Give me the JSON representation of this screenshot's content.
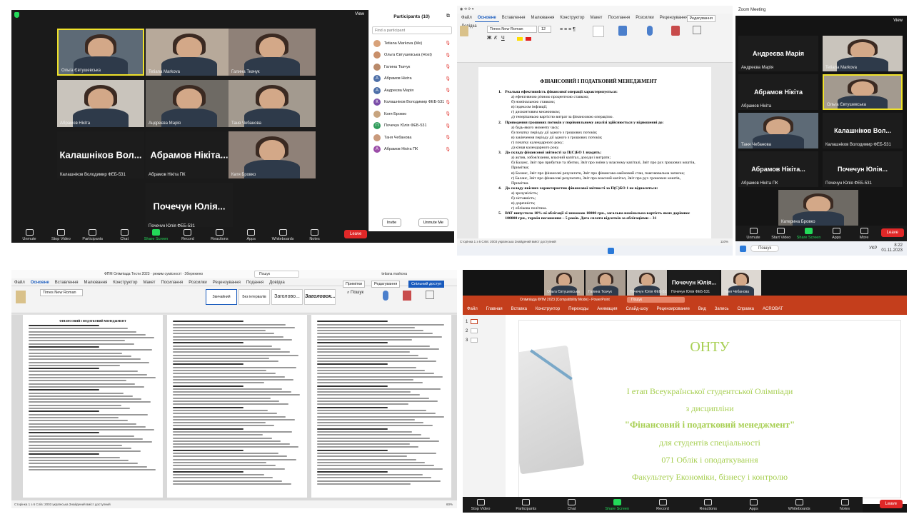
{
  "q1": {
    "view_label": "View",
    "tiles": [
      {
        "name": "Ольга Євтушевська",
        "type": "photo"
      },
      {
        "name": "Tetiana Markova",
        "type": "photo"
      },
      {
        "name": "Галина Ткачук",
        "type": "photo"
      },
      {
        "name": "Абрамов Нікіта",
        "type": "photo"
      },
      {
        "name": "Андреєва Марія",
        "type": "photo"
      },
      {
        "name": "Таня Чебанова",
        "type": "photo"
      },
      {
        "name": "Калашніков Володимир ФЕБ-531",
        "type": "text",
        "big": "Калашніков Вол..."
      },
      {
        "name": "Абрамов Нікіта ПК",
        "type": "text",
        "big": "Абрамов Нікіта..."
      },
      {
        "name": "Катя Бровко",
        "type": "photo"
      },
      {
        "name": "Почечун Юлія ФЕБ-531",
        "type": "text",
        "big": "Почечун Юлія..."
      }
    ],
    "participants": {
      "title": "Participants (10)",
      "search_placeholder": "Find a participant",
      "list": [
        {
          "name": "Tetiana Markova (Me)",
          "color": "#d8a27a"
        },
        {
          "name": "Ольга Євтушевська (Host)",
          "color": "#c9906b"
        },
        {
          "name": "Галина Ткачук",
          "color": "#b98a6a"
        },
        {
          "name": "Абрамов Нікіта",
          "color": "#4d6fa8",
          "letter": "А"
        },
        {
          "name": "Андреєва Марія",
          "color": "#4d6fa8",
          "letter": "А"
        },
        {
          "name": "Калашніков Володимир ФЕБ-531",
          "color": "#7a4da8",
          "letter": "К"
        },
        {
          "name": "Катя Бровко",
          "color": "#c7a47f"
        },
        {
          "name": "Почечун Юлія ФЕБ-531",
          "color": "#2f9c5a",
          "letter": "П"
        },
        {
          "name": "Таня Чебанова",
          "color": "#c99a7c"
        },
        {
          "name": "Абрамов Нікіта ПК",
          "color": "#9b4da8",
          "letter": "А"
        }
      ],
      "invite": "Invite",
      "unmute": "Unmute Me"
    },
    "toolbar": [
      "Unmute",
      "Stop Video",
      "Participants",
      "Chat",
      "Share Screen",
      "Record",
      "Reactions",
      "Apps",
      "Whiteboards",
      "Notes"
    ],
    "leave": "Leave"
  },
  "q2": {
    "tabs": [
      "Файл",
      "Основне",
      "Вставлення",
      "Малювання",
      "Конструктор",
      "Макет",
      "Посилання",
      "Розсилки",
      "Рецензування",
      "Подання",
      "Довідка"
    ],
    "font": "Times New Roman",
    "size": "12",
    "edit_label": "Редагування",
    "title": "ФІНАНСОВИЙ І ПОДАТКОВИЙ МЕНЕДЖМЕНТ",
    "questions": [
      {
        "num": "1.",
        "q": "Реальна ефективність фінансової операції характеризується:",
        "a": [
          "а) ефективною річною процентною ставкою;",
          "б) номінальною ставкою;",
          "в) індексом інфляції;",
          "г) дисконтовим множником;",
          "д) теперішньою вартістю витрат за фінансовою операцією."
        ]
      },
      {
        "num": "2.",
        "q": "Приведення грошових потоків у порівняльному аналізі здійснюється у відношенні до:",
        "a": [
          "а) будь-якого моменту часу;",
          "б) початку періоду дії одного з грошових потоків;",
          "в) закінчення періоду дії одного з грошових потоків;",
          "г) початку календарного року;",
          "д) кінця календарного року."
        ]
      },
      {
        "num": "3.",
        "q": "До складу фінансової звітності за П(С)БО 1 входять:",
        "a": [
          "а) актив, зобов'язання, власний капітал, доходи і витрати;",
          "б) Баланс, Звіт про прибутки та збитки, Звіт про зміни у власному капіталі, Звіт про рух грошових коштів, Примітки;",
          "в) Баланс, Звіт про фінансові результати, Звіт про фінансово-майновий стан, пояснювальна записка;",
          "г) Баланс, Звіт про фінансові результати, Звіт про власний капітал, Звіт про рух грошових коштів, Примітки."
        ]
      },
      {
        "num": "4.",
        "q": "До складу якісних характеристик фінансової звітності за П(С)БО 1 не відноситься:",
        "a": [
          "а) зрозумілість;",
          "б) зіставність;",
          "в) доречність;",
          "г) обліковa політика."
        ]
      },
      {
        "num": "5.",
        "q": "ВАТ випустило 10%-ві облігації зі знижкою 10000 грн., загальна номінальна вартість яких дорівнює 100000 грн., термін погашення – 5 років. Дата сплати відсотків за облігаціями – 31",
        "a": []
      }
    ],
    "status": "Сторінка 1 з 6   Слів: 2003   українська   Знайдений вміст доступний",
    "zoom": "110%"
  },
  "q3": {
    "view_label": "View",
    "tiles": [
      {
        "name": "Андреєва Марія",
        "type": "text",
        "big": "Андреєва Марія"
      },
      {
        "name": "Tetiana Markova",
        "type": "photo"
      },
      {
        "name": "Абрамов Нікіта",
        "type": "text",
        "big": "Абрамов Нікіта"
      },
      {
        "name": "Ольга Євтушевська",
        "type": "photo"
      },
      {
        "name": "Таня Чебанова",
        "type": "photo"
      },
      {
        "name": "Калашніков Володимир ФЕБ-531",
        "type": "text",
        "big": "Калашніков Вол..."
      },
      {
        "name": "Абрамов Нікіта ПК",
        "type": "text",
        "big": "Абрамов Нікіта..."
      },
      {
        "name": "Почечун Юлія ФЕБ-531",
        "type": "text",
        "big": "Почечун Юлія..."
      },
      {
        "name": "Катерина Бровко",
        "type": "photo"
      }
    ],
    "toolbar": [
      "Unmute",
      "Start Video",
      "Share Screen",
      "Apps",
      "More"
    ],
    "leave": "Leave",
    "clock": "8:22",
    "date": "01.11.2023",
    "lang": "УКР",
    "search": "Пошук"
  },
  "q4": {
    "title": "ФПМ Олімпіада Тести 2023 · режим сумісності · Збережено",
    "user": "tetiana markova",
    "search": "Пошук",
    "tabs": [
      "Файл",
      "Основне",
      "Вставлення",
      "Малювання",
      "Конструктор",
      "Макет",
      "Посилання",
      "Розсилки",
      "Рецензування",
      "Подання",
      "Довідка"
    ],
    "styles": [
      "Звичайний",
      "Без інтервалів",
      "Заголово...",
      "Заголовок..."
    ],
    "share": "Спільний доступ",
    "comments": "Примітки",
    "edit": "Редагування",
    "status": "Сторінка 1 з 6   Слів: 2003   українська   Знайдений вміст доступний",
    "zoom": "60%",
    "doc_title": "ФІНАНСОВИЙ І ПОДАТКОВИЙ МЕНЕДЖМЕНТ"
  },
  "q5": {
    "names": [
      "Ольга Євтушевська",
      "Галина Ткачук",
      "Почечун Юлія ФЕБ-531",
      "Таня Чебанова"
    ],
    "big_name": "Почечун Юлія...",
    "app_title": "Олімпіада ФПМ 2023 [Compatibility Mode] - PowerPoint",
    "search": "Пошук",
    "tabs": [
      "Файл",
      "Главная",
      "Вставка",
      "Конструктор",
      "Переходы",
      "Анимация",
      "Слайд-шоу",
      "Рецензирование",
      "Вид",
      "Запись",
      "Справка",
      "ACROBAT"
    ],
    "slide": {
      "org": "ОНТУ",
      "l1": "І етап Всеукраїнської студентської Олімпіади",
      "l2": "з дисципліни",
      "l3": "\"Фінансовий і податковий менеджмент\"",
      "l4": "для студентів спеціальності",
      "l5": "071 Облік і оподаткування",
      "l6": "Факультету Економіки, бізнесу і контролю"
    },
    "thumbs": [
      "1",
      "2",
      "3"
    ],
    "toolbar": [
      "Stop Video",
      "Participants",
      "Chat",
      "Share Screen",
      "Record",
      "Reactions",
      "Apps",
      "Whiteboards",
      "Notes"
    ],
    "leave": "Leave"
  }
}
